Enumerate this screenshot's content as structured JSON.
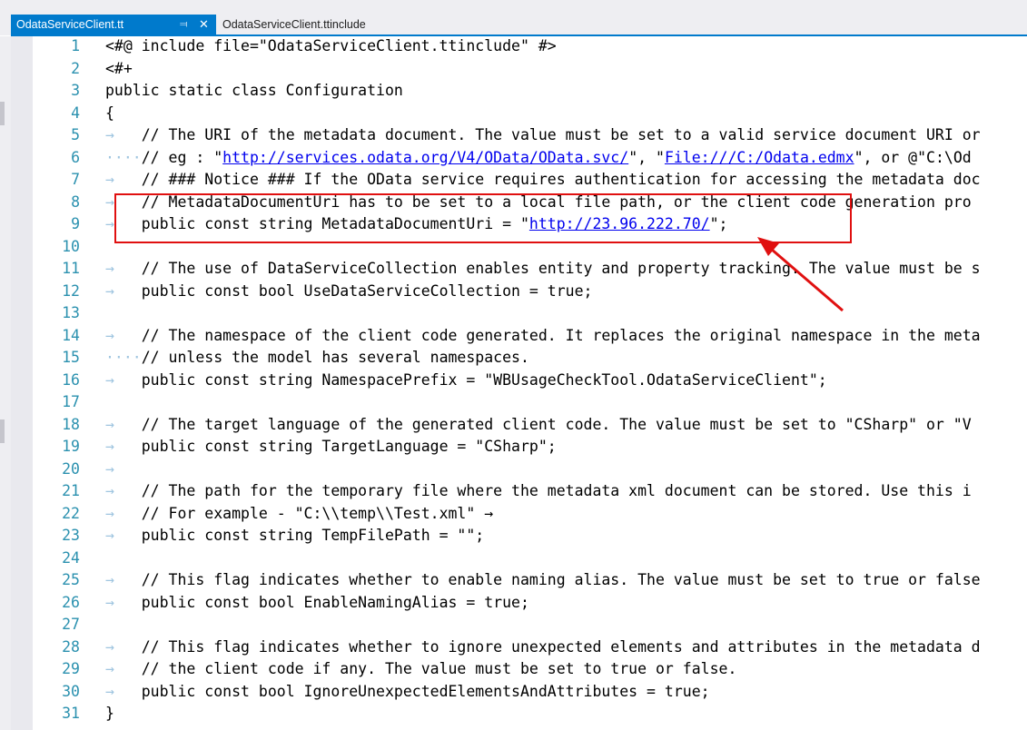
{
  "tabs": [
    {
      "label": "OdataServiceClient.tt",
      "active": true,
      "pin_icon": "pin-icon",
      "close_icon": "close-icon"
    },
    {
      "label": "OdataServiceClient.ttinclude",
      "active": false
    }
  ],
  "colors": {
    "accent": "#007acc",
    "line_number": "#2b91af",
    "link": "#0000ee",
    "annotation": "#e01010"
  },
  "lines": [
    {
      "n": "1",
      "ws": "",
      "text": "<#@ include file=\"OdataServiceClient.ttinclude\" #>"
    },
    {
      "n": "2",
      "ws": "",
      "text": "<#+"
    },
    {
      "n": "3",
      "ws": "",
      "text": "public static class Configuration"
    },
    {
      "n": "4",
      "ws": "",
      "text": "{"
    },
    {
      "n": "5",
      "ws": "→",
      "text": "// The URI of the metadata document. The value must be set to a valid service document URI or"
    },
    {
      "n": "6",
      "ws": "····",
      "text": "// eg : \"",
      "link1": "http://services.odata.org/V4/OData/OData.svc/",
      "mid": "\", \"",
      "link2": "File:///C:/Odata.edmx",
      "tail": "\", or @\"C:\\Od"
    },
    {
      "n": "7",
      "ws": "→",
      "text": "// ### Notice ### If the OData service requires authentication for accessing the metadata doc"
    },
    {
      "n": "8",
      "ws": "→",
      "text": "// MetadataDocumentUri has to be set to a local file path, or the client code generation pro"
    },
    {
      "n": "9",
      "ws": "→",
      "text": "public const string MetadataDocumentUri = \"",
      "link1": "http://23.96.222.70/",
      "tail": "\";"
    },
    {
      "n": "10",
      "ws": "",
      "text": ""
    },
    {
      "n": "11",
      "ws": "→",
      "text": "// The use of DataServiceCollection enables entity and property tracking. The value must be s"
    },
    {
      "n": "12",
      "ws": "→",
      "text": "public const bool UseDataServiceCollection = true;"
    },
    {
      "n": "13",
      "ws": "",
      "text": ""
    },
    {
      "n": "14",
      "ws": "→",
      "text": "// The namespace of the client code generated. It replaces the original namespace in the meta"
    },
    {
      "n": "15",
      "ws": "····",
      "text": "// unless the model has several namespaces."
    },
    {
      "n": "16",
      "ws": "→",
      "text": "public const string NamespacePrefix = \"WBUsageCheckTool.OdataServiceClient\";"
    },
    {
      "n": "17",
      "ws": "",
      "text": ""
    },
    {
      "n": "18",
      "ws": "→",
      "text": "// The target language of the generated client code. The value must be set to \"CSharp\" or \"V"
    },
    {
      "n": "19",
      "ws": "→",
      "text": "public const string TargetLanguage = \"CSharp\";"
    },
    {
      "n": "20",
      "ws": "→",
      "text": ""
    },
    {
      "n": "21",
      "ws": "→",
      "text": "// The path for the temporary file where the metadata xml document can be stored. Use this i"
    },
    {
      "n": "22",
      "ws": "→",
      "text": "// For example - \"C:\\\\temp\\\\Test.xml\" →"
    },
    {
      "n": "23",
      "ws": "→",
      "text": "public const string TempFilePath = \"\";"
    },
    {
      "n": "24",
      "ws": "",
      "text": ""
    },
    {
      "n": "25",
      "ws": "→",
      "text": "// This flag indicates whether to enable naming alias. The value must be set to true or false"
    },
    {
      "n": "26",
      "ws": "→",
      "text": "public const bool EnableNamingAlias = true;"
    },
    {
      "n": "27",
      "ws": "",
      "text": ""
    },
    {
      "n": "28",
      "ws": "→",
      "text": "// This flag indicates whether to ignore unexpected elements and attributes in the metadata d"
    },
    {
      "n": "29",
      "ws": "→",
      "text": "// the client code if any. The value must be set to true or false."
    },
    {
      "n": "30",
      "ws": "→",
      "text": "public const bool IgnoreUnexpectedElementsAndAttributes = true;"
    },
    {
      "n": "31",
      "ws": "",
      "text": "}"
    }
  ]
}
